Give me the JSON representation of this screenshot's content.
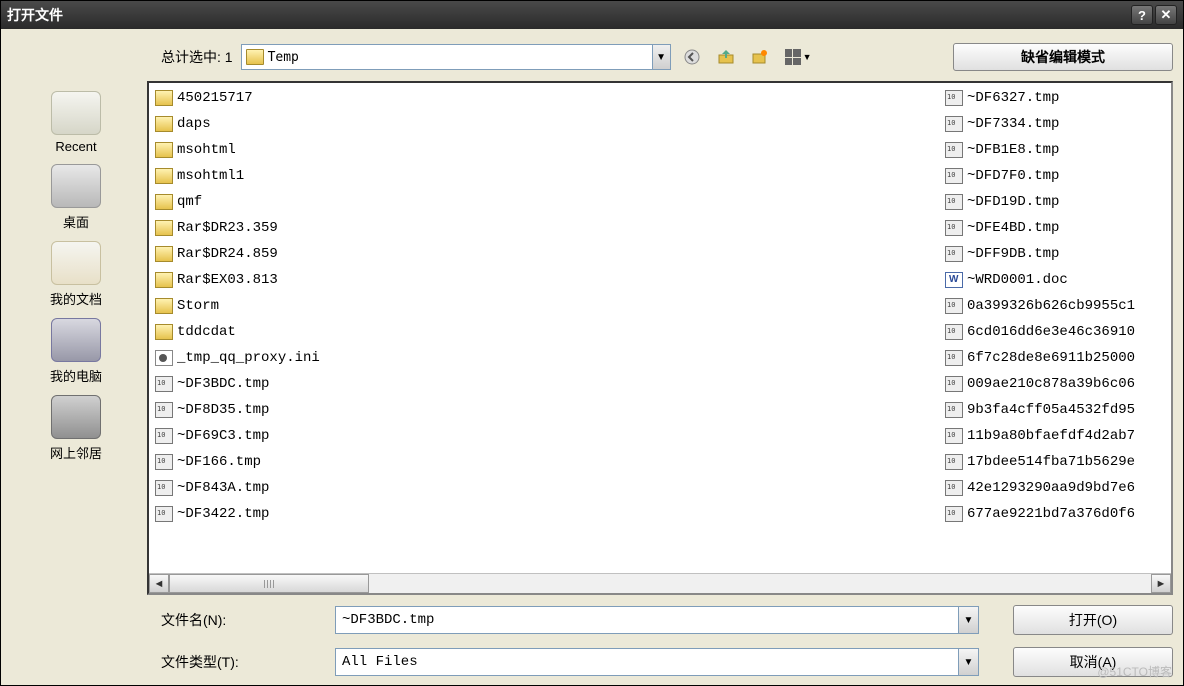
{
  "title": "打开文件",
  "selection_label": "总计选中: 1",
  "path": "Temp",
  "editmode_button": "缺省编辑模式",
  "leftbar": [
    {
      "label": "Recent",
      "icon": "icon-recent"
    },
    {
      "label": "桌面",
      "icon": "icon-desktop"
    },
    {
      "label": "我的文档",
      "icon": "icon-docs"
    },
    {
      "label": "我的电脑",
      "icon": "icon-comp"
    },
    {
      "label": "网上邻居",
      "icon": "icon-net"
    }
  ],
  "files_col1": [
    {
      "name": "450215717",
      "type": "folder"
    },
    {
      "name": "daps",
      "type": "folder"
    },
    {
      "name": "msohtml",
      "type": "folder"
    },
    {
      "name": "msohtml1",
      "type": "folder"
    },
    {
      "name": "qmf",
      "type": "folder"
    },
    {
      "name": "Rar$DR23.359",
      "type": "folder"
    },
    {
      "name": "Rar$DR24.859",
      "type": "folder"
    },
    {
      "name": "Rar$EX03.813",
      "type": "folder"
    },
    {
      "name": "Storm",
      "type": "folder"
    },
    {
      "name": "tddcdat",
      "type": "folder"
    },
    {
      "name": "_tmp_qq_proxy.ini",
      "type": "ini"
    },
    {
      "name": "~DF3BDC.tmp",
      "type": "tmp"
    },
    {
      "name": "~DF8D35.tmp",
      "type": "tmp"
    },
    {
      "name": "~DF69C3.tmp",
      "type": "tmp"
    },
    {
      "name": "~DF166.tmp",
      "type": "tmp"
    },
    {
      "name": "~DF843A.tmp",
      "type": "tmp"
    },
    {
      "name": "~DF3422.tmp",
      "type": "tmp"
    }
  ],
  "files_col2": [
    {
      "name": "~DF6327.tmp",
      "type": "tmp"
    },
    {
      "name": "~DF7334.tmp",
      "type": "tmp"
    },
    {
      "name": "~DFB1E8.tmp",
      "type": "tmp"
    },
    {
      "name": "~DFD7F0.tmp",
      "type": "tmp"
    },
    {
      "name": "~DFD19D.tmp",
      "type": "tmp"
    },
    {
      "name": "~DFE4BD.tmp",
      "type": "tmp"
    },
    {
      "name": "~DFF9DB.tmp",
      "type": "tmp"
    },
    {
      "name": "~WRD0001.doc",
      "type": "doc"
    },
    {
      "name": "0a399326b626cb9955c1",
      "type": "tmp"
    },
    {
      "name": "6cd016dd6e3e46c36910",
      "type": "tmp"
    },
    {
      "name": "6f7c28de8e6911b25000",
      "type": "tmp"
    },
    {
      "name": "009ae210c878a39b6c06",
      "type": "tmp"
    },
    {
      "name": "9b3fa4cff05a4532fd95",
      "type": "tmp"
    },
    {
      "name": "11b9a80bfaefdf4d2ab7",
      "type": "tmp"
    },
    {
      "name": "17bdee514fba71b5629e",
      "type": "tmp"
    },
    {
      "name": "42e1293290aa9d9bd7e6",
      "type": "tmp"
    },
    {
      "name": "677ae9221bd7a376d0f6",
      "type": "tmp"
    }
  ],
  "filename_label": "文件名(N):",
  "filename_value": "~DF3BDC.tmp",
  "filetype_label": "文件类型(T):",
  "filetype_value": "All Files",
  "open_button": "打开(O)",
  "cancel_button": "取消(A)",
  "watermark": "@51CTO博客"
}
